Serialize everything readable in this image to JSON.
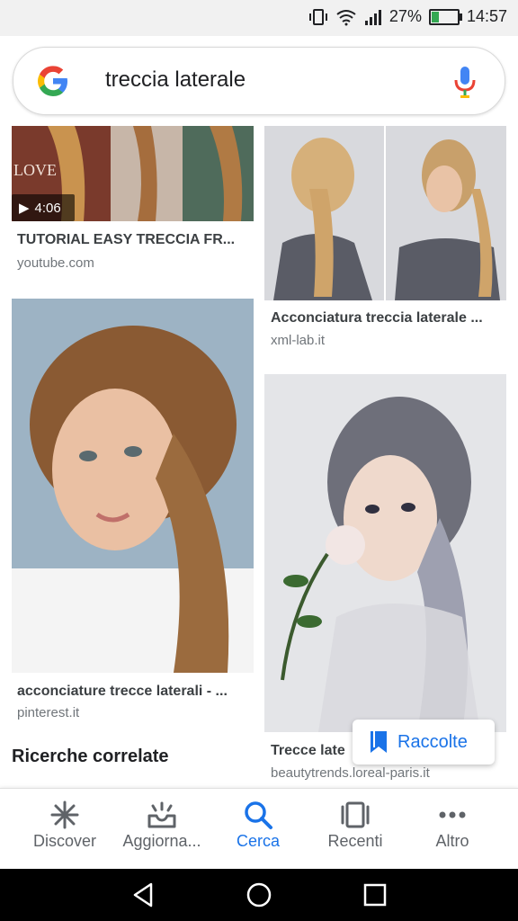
{
  "status_bar": {
    "battery": "27%",
    "battery_level": 0.27,
    "time": "14:57",
    "icons": [
      "vibrate-icon",
      "wifi-icon",
      "signal-icon",
      "battery-charging-icon"
    ]
  },
  "search": {
    "query": "treccia laterale",
    "icons": [
      "google-logo",
      "mic-icon"
    ]
  },
  "results": [
    {
      "title": "TUTORIAL EASY TRECCIA FR...",
      "source": "youtube.com",
      "duration": "4:06"
    },
    {
      "title": "Acconciatura treccia laterale ...",
      "source": "xml-lab.it"
    },
    {
      "title": "acconciature trecce laterali - ...",
      "source": "pinterest.it"
    },
    {
      "title": "Trecce late",
      "source": "beautytrends.loreal-paris.it"
    }
  ],
  "related_searches_title": "Ricerche correlate",
  "collections_button": "Raccolte",
  "bottom_nav": [
    {
      "label": "Discover",
      "icon": "asterisk-icon"
    },
    {
      "label": "Aggiorna...",
      "icon": "updates-tray-icon"
    },
    {
      "label": "Cerca",
      "icon": "search-icon"
    },
    {
      "label": "Recenti",
      "icon": "recent-cards-icon"
    },
    {
      "label": "Altro",
      "icon": "more-dots-icon"
    }
  ],
  "colors": {
    "accent": "#1a73e8",
    "text": "#202124",
    "secondary": "#70757a"
  }
}
